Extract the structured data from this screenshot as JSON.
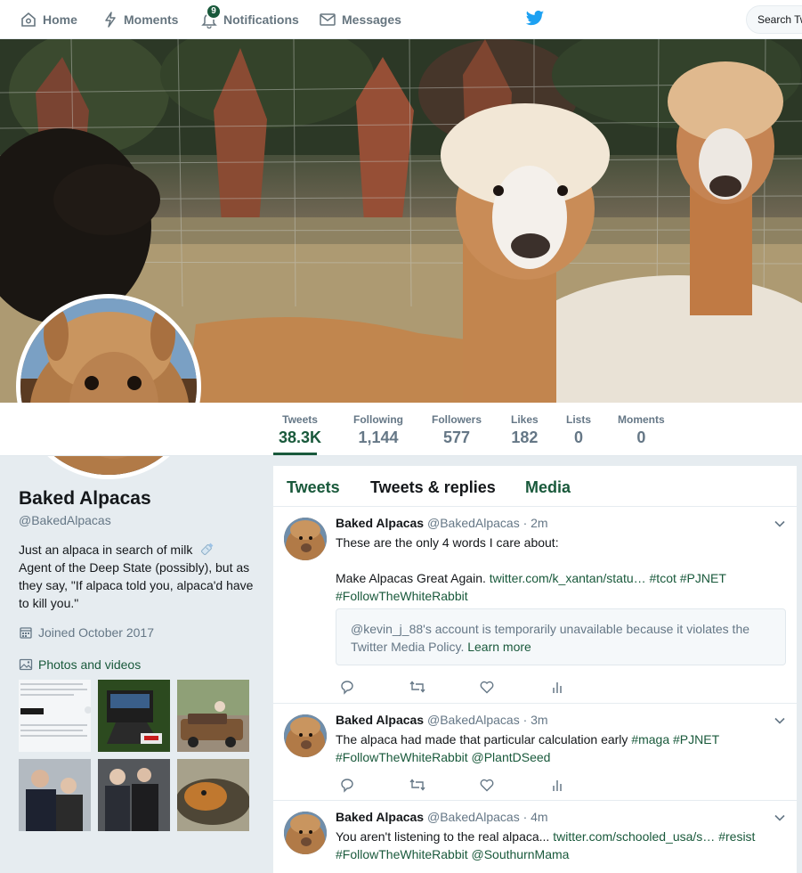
{
  "nav": {
    "home": "Home",
    "moments": "Moments",
    "notifications": "Notifications",
    "notifications_count": "9",
    "messages": "Messages",
    "search_placeholder": "Search Tw"
  },
  "stats": [
    {
      "label": "Tweets",
      "value": "38.3K"
    },
    {
      "label": "Following",
      "value": "1,144"
    },
    {
      "label": "Followers",
      "value": "577"
    },
    {
      "label": "Likes",
      "value": "182"
    },
    {
      "label": "Lists",
      "value": "0"
    },
    {
      "label": "Moments",
      "value": "0"
    }
  ],
  "profile": {
    "name": "Baked Alpacas",
    "handle": "@BakedAlpacas",
    "bio_line1": "Just an alpaca in search of milk",
    "bio_rest": "Agent of the Deep State (possibly), but as they say, \"If alpaca told you, alpaca'd have to kill you.\"",
    "joined": "Joined October 2017",
    "photos_label": "Photos and videos"
  },
  "tabs": {
    "tweets": "Tweets",
    "replies": "Tweets & replies",
    "media": "Media"
  },
  "tweets": [
    {
      "name": "Baked Alpacas",
      "handle": "@BakedAlpacas",
      "time": "· 2m",
      "line1": "These are the only 4 words I care about:",
      "line2_text": "Make Alpacas Great Again.",
      "line2_link": "twitter.com/k_xantan/statu…",
      "line2_tags": "#tcot #PJNET",
      "line3_tags": "#FollowTheWhiteRabbit",
      "notice": "@kevin_j_88's account is temporarily unavailable because it violates the Twitter Media Policy.",
      "notice_link": "Learn more"
    },
    {
      "name": "Baked Alpacas",
      "handle": "@BakedAlpacas",
      "time": "· 3m",
      "line1_text": "The alpaca had made that particular calculation early",
      "line1_tags": "#maga #PJNET",
      "line2_tags": "#FollowTheWhiteRabbit @PlantDSeed"
    },
    {
      "name": "Baked Alpacas",
      "handle": "@BakedAlpacas",
      "time": "· 4m",
      "line1_text": "You aren't listening to the real alpaca...",
      "line1_link": "twitter.com/schooled_usa/s…",
      "line1_tags": "#resist",
      "line2_tags": "#FollowTheWhiteRabbit @SouthurnMama"
    }
  ],
  "colors": {
    "accent": "#19593b",
    "twitter_blue": "#1da1f2",
    "muted": "#657786",
    "background": "#e6ecf0"
  }
}
